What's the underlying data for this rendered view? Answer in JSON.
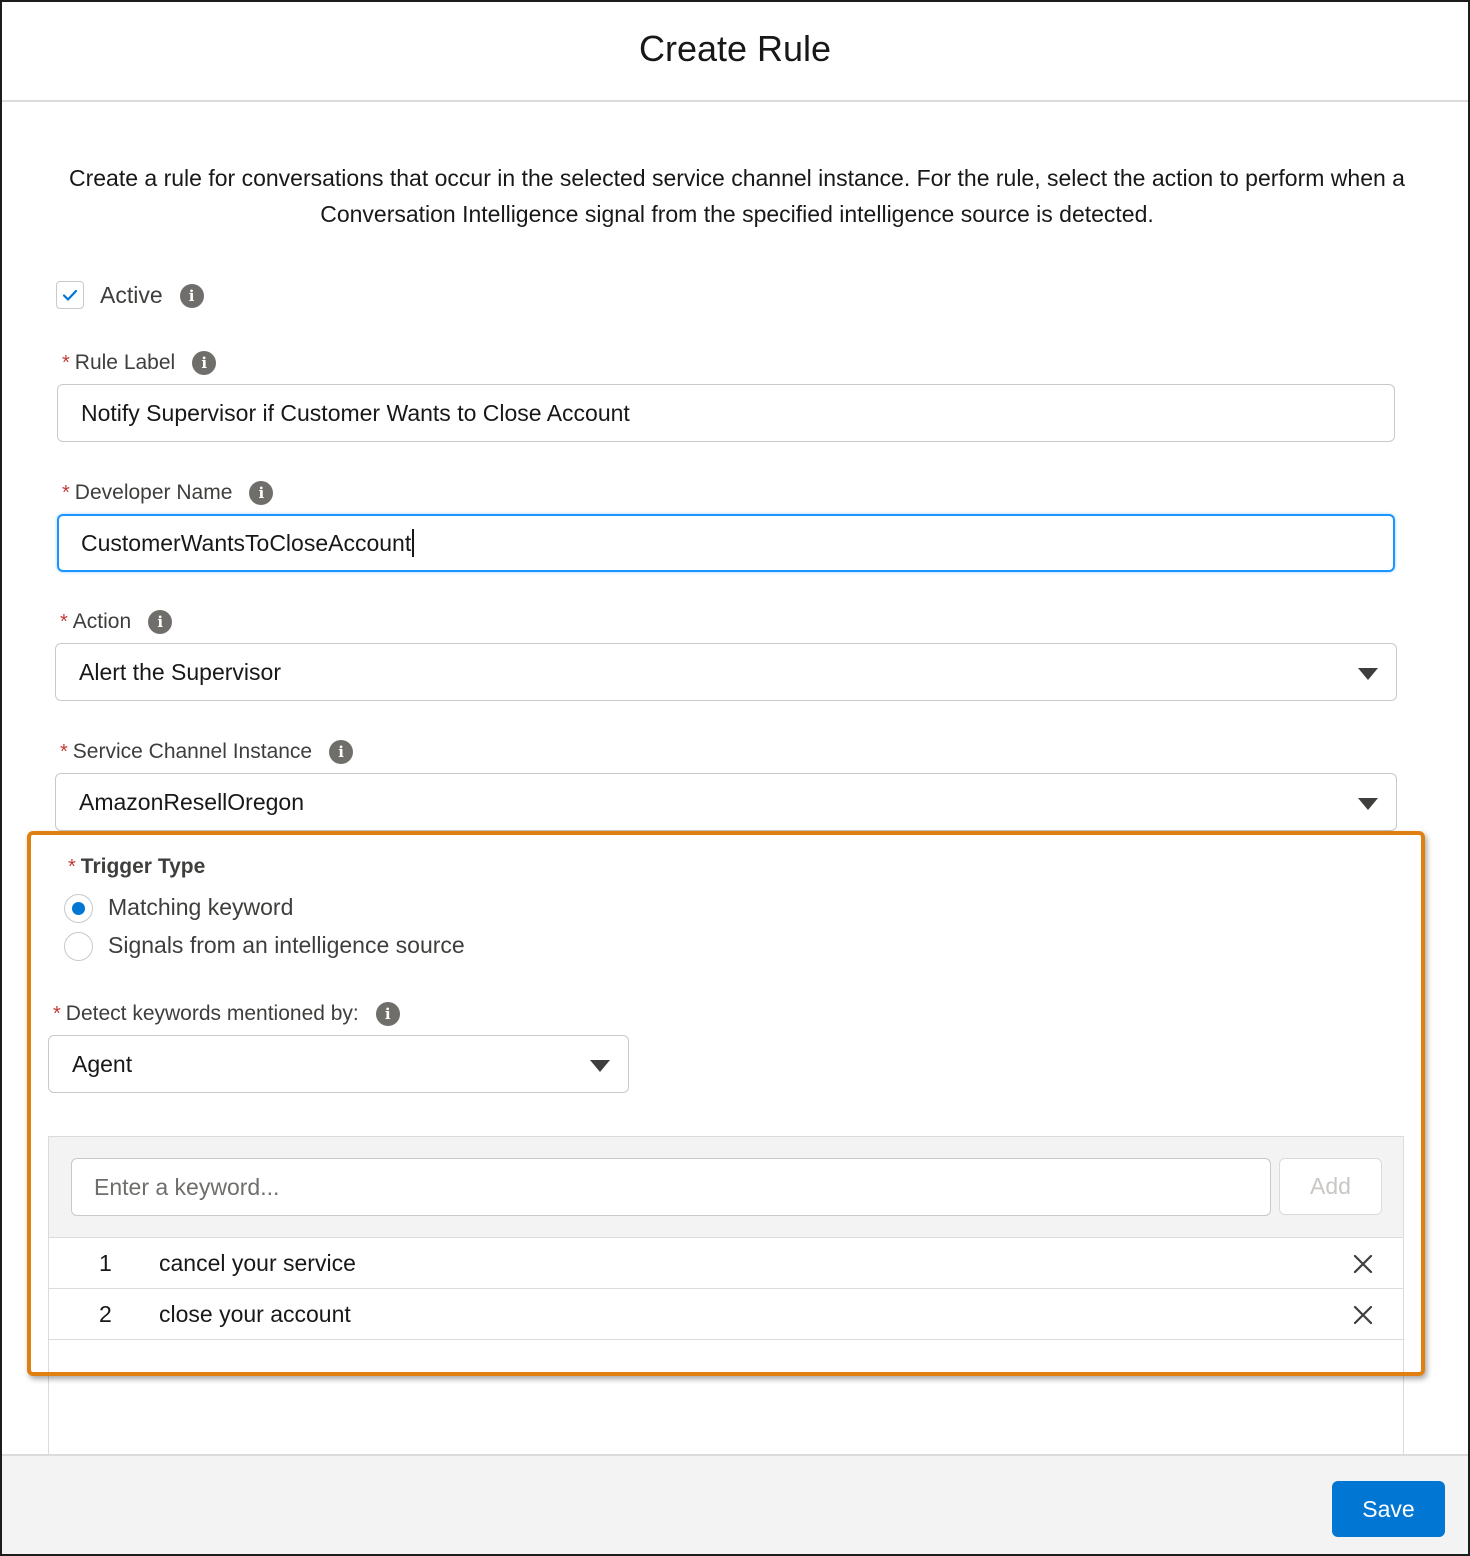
{
  "modal": {
    "title": "Create Rule",
    "intro": "Create a rule for conversations that occur in the selected service channel instance. For the rule, select the action to perform when a Conversation Intelligence signal from the specified intelligence source is detected."
  },
  "form": {
    "active": {
      "label": "Active",
      "checked": true
    },
    "rule_label": {
      "label": "Rule Label",
      "value": "Notify Supervisor if Customer Wants to Close Account"
    },
    "developer_name": {
      "label": "Developer Name",
      "value": "CustomerWantsToCloseAccount"
    },
    "action": {
      "label": "Action",
      "value": "Alert the Supervisor"
    },
    "service_channel_instance": {
      "label": "Service Channel Instance",
      "value": "AmazonResellOregon"
    },
    "trigger_type": {
      "label": "Trigger Type",
      "options": [
        "Matching keyword",
        "Signals from an intelligence source"
      ],
      "selected": "Matching keyword"
    },
    "detect_keywords": {
      "label": "Detect keywords mentioned by:",
      "value": "Agent"
    },
    "keywords": {
      "placeholder": "Enter a keyword...",
      "add_label": "Add",
      "items": [
        {
          "num": "1",
          "text": "cancel your service"
        },
        {
          "num": "2",
          "text": "close your account"
        }
      ]
    }
  },
  "footer": {
    "save_label": "Save"
  },
  "colors": {
    "accent": "#0176d3",
    "highlight": "#e07f12",
    "required": "#c23934"
  }
}
